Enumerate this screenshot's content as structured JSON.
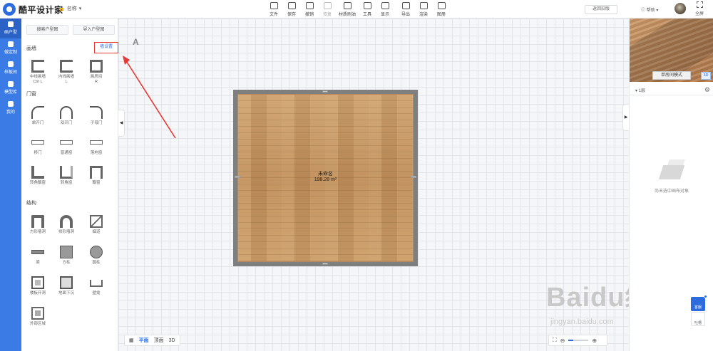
{
  "app": {
    "logo_text": "酷平设计家",
    "project_name": "名称"
  },
  "toolbar": {
    "items": [
      {
        "label": "文件",
        "icon": "file-icon",
        "disabled": false
      },
      {
        "label": "保存",
        "icon": "save-icon",
        "disabled": false
      },
      {
        "label": "撤销",
        "icon": "undo-icon",
        "disabled": false
      },
      {
        "label": "恢复",
        "icon": "redo-icon",
        "disabled": true
      },
      {
        "label": "材质刷油",
        "icon": "brush-icon",
        "disabled": false
      },
      {
        "label": "工具",
        "icon": "tools-icon",
        "disabled": false
      },
      {
        "label": "显示",
        "icon": "eye-icon",
        "disabled": false
      },
      {
        "label": "导出",
        "icon": "export-icon",
        "disabled": false
      },
      {
        "label": "渲染",
        "icon": "render-icon",
        "disabled": false
      },
      {
        "label": "图册",
        "icon": "album-icon",
        "disabled": false
      }
    ],
    "back_old": "返回旧版",
    "help": "帮助",
    "fullscreen": "全屏"
  },
  "leftnav": {
    "items": [
      {
        "label": "画户型",
        "icon": "floorplan-icon",
        "active": true
      },
      {
        "label": "做定制",
        "icon": "custom-icon",
        "active": false
      },
      {
        "label": "样板间",
        "icon": "house-icon",
        "active": false
      },
      {
        "label": "模型库",
        "icon": "box-icon",
        "active": false
      },
      {
        "label": "我的",
        "icon": "user-icon",
        "active": false
      }
    ]
  },
  "panel": {
    "tabs": [
      "搜索户型图",
      "导入户型图"
    ],
    "wall_section": "画墙",
    "wall_button": "墙设置",
    "walls": [
      {
        "label": "中线画墙",
        "sub": "Ctrl L",
        "icon": "wall-c"
      },
      {
        "label": "内线画墙",
        "sub": "L",
        "icon": "wall-c2"
      },
      {
        "label": "画房间",
        "sub": "R",
        "icon": "room"
      }
    ],
    "door_section": "门窗",
    "doors": [
      {
        "label": "单开门",
        "icon": "door"
      },
      {
        "label": "双开门",
        "icon": "door2"
      },
      {
        "label": "子母门",
        "icon": "door3"
      },
      {
        "label": "移门",
        "icon": "win"
      },
      {
        "label": "普通窗",
        "icon": "win"
      },
      {
        "label": "落地窗",
        "icon": "win"
      },
      {
        "label": "转角飘窗",
        "icon": "corner"
      },
      {
        "label": "转角窗",
        "icon": "corner2"
      },
      {
        "label": "飘窗",
        "icon": "bay"
      }
    ],
    "struct_section": "结构",
    "structs": [
      {
        "label": "方形墙洞",
        "icon": "arch"
      },
      {
        "label": "拱形墙洞",
        "icon": "arch2"
      },
      {
        "label": "烟道",
        "icon": "niche"
      },
      {
        "label": "梁",
        "icon": "beam"
      },
      {
        "label": "方柱",
        "icon": "square"
      },
      {
        "label": "圆柱",
        "icon": "round"
      },
      {
        "label": "楼板开洞",
        "icon": "flue"
      },
      {
        "label": "地面下沉",
        "icon": "drop"
      },
      {
        "label": "壁龛",
        "icon": "shelf"
      },
      {
        "label": "外部区域",
        "icon": "outer"
      }
    ]
  },
  "canvas": {
    "room_name": "未命名",
    "room_area": "198.28 m²",
    "views": [
      "平面",
      "顶面",
      "3D"
    ],
    "active_view": "平面"
  },
  "right": {
    "preview_mode": "单房间模式",
    "preview_3d": "3D",
    "floor": "1层",
    "empty_text": "尚未选中画布对象",
    "feedback": "客服",
    "comment": "吐槽"
  },
  "watermark": {
    "main": "Baidu经验",
    "sub": "jingyan.baidu.com"
  },
  "colors": {
    "accent": "#3b7be6",
    "highlight": "#e53935",
    "floor_wood": "#c89a66",
    "wall": "#7f7f7f"
  }
}
